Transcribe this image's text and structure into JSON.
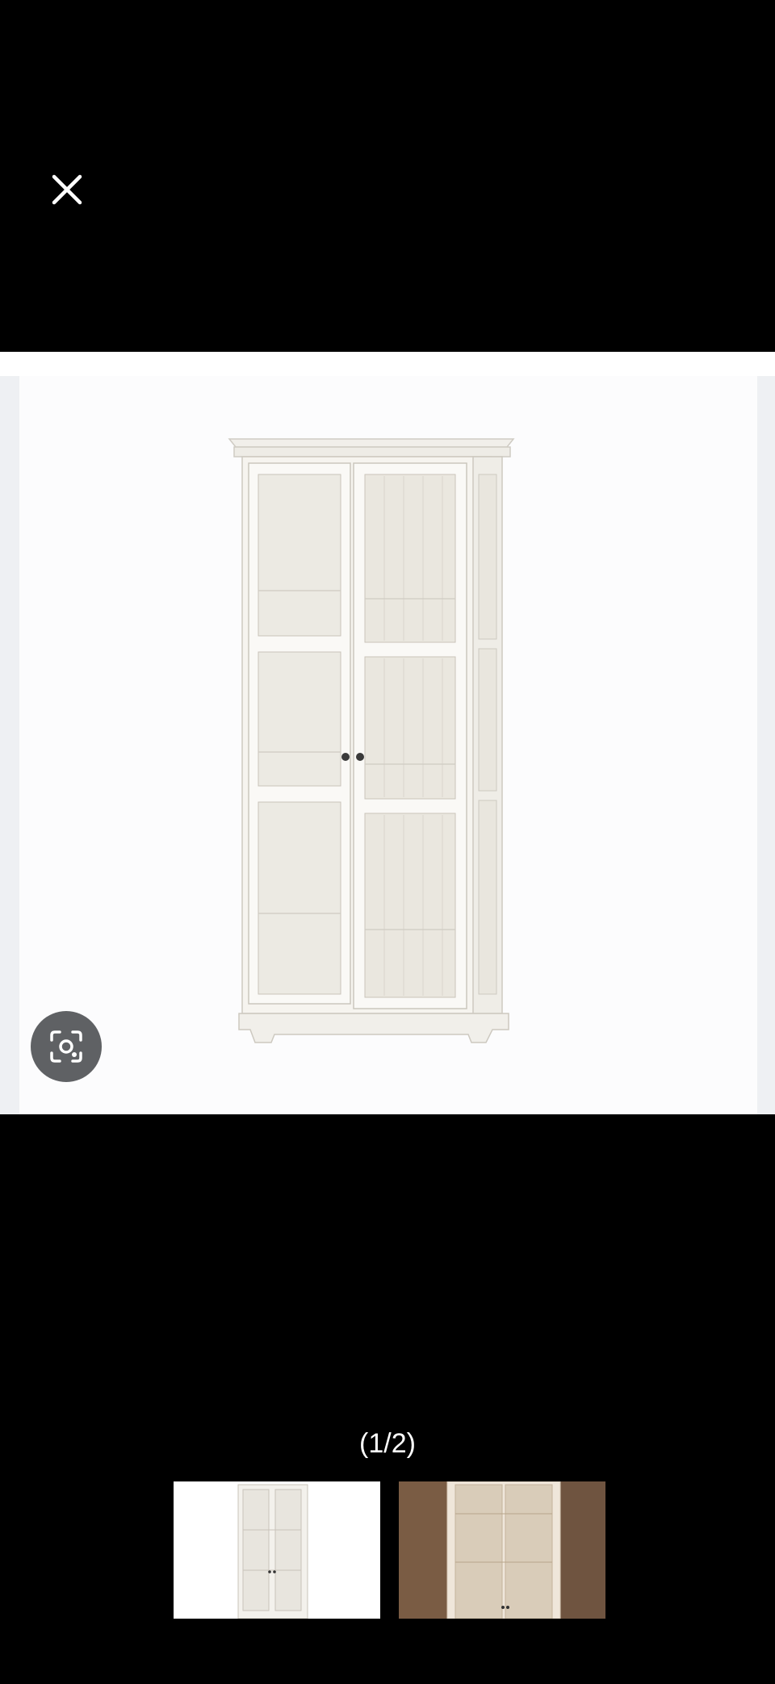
{
  "viewer": {
    "counter": "(1/2)"
  },
  "icons": {
    "close": "close-icon",
    "lens": "lens-icon"
  },
  "thumbnails": [
    {
      "name": "white-glass-door-cabinet",
      "selected": true
    },
    {
      "name": "cabinet-in-room-photo",
      "selected": false
    }
  ],
  "colors": {
    "background": "#000000",
    "lens_button": "#5f6164"
  }
}
